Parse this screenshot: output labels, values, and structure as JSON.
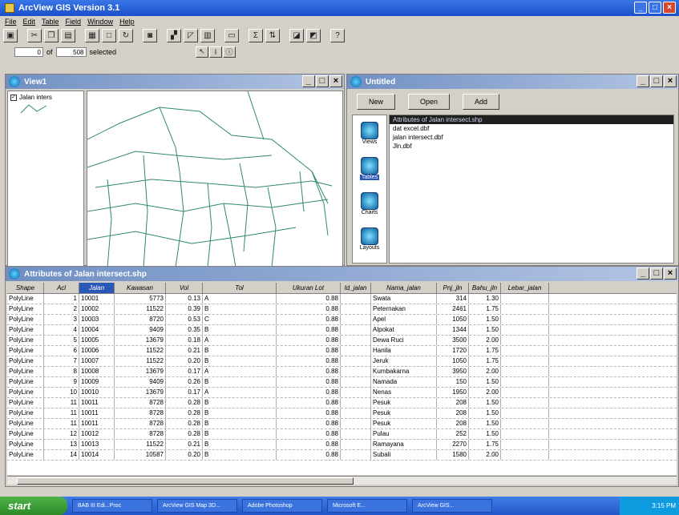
{
  "app": {
    "title": "ArcView GIS Version 3.1"
  },
  "menu": [
    "File",
    "Edit",
    "Table",
    "Field",
    "Window",
    "Help"
  ],
  "selection": {
    "count": "0",
    "of_label": "of",
    "total": "508",
    "selected_label": "selected"
  },
  "view_window": {
    "title": "View1",
    "toc_layers": [
      {
        "label": "Jalan inters",
        "checked": true
      }
    ]
  },
  "project_window": {
    "title": "Untitled",
    "buttons": [
      "New",
      "Open",
      "Add"
    ],
    "doc_types": [
      {
        "label": "Views",
        "selected": false
      },
      {
        "label": "Tables",
        "selected": true
      },
      {
        "label": "Charts",
        "selected": false
      },
      {
        "label": "Layouts",
        "selected": false
      }
    ],
    "tables": [
      {
        "name": "Attributes of Jalan intersect.shp",
        "selected": true
      },
      {
        "name": "dat excel.dbf",
        "selected": false
      },
      {
        "name": "jalan intersect.dbf",
        "selected": false
      },
      {
        "name": "Jln.dbf",
        "selected": false
      }
    ]
  },
  "table_window": {
    "title": "Attributes of Jalan intersect.shp",
    "columns": [
      {
        "label": "Shape",
        "selected": false
      },
      {
        "label": "Acl",
        "selected": false
      },
      {
        "label": "Jalan",
        "selected": true
      },
      {
        "label": "Kawasan",
        "selected": false
      },
      {
        "label": "Vol",
        "selected": false
      },
      {
        "label": "Tol",
        "selected": false
      },
      {
        "label": "Ukuran Lot",
        "selected": false
      },
      {
        "label": "Id_jalan",
        "selected": false
      },
      {
        "label": "Nama_jalan",
        "selected": false
      },
      {
        "label": "Pnj_jln",
        "selected": false
      },
      {
        "label": "Bahu_jln",
        "selected": false
      },
      {
        "label": "Lebar_jalan",
        "selected": false
      }
    ],
    "rows": [
      [
        "PolyLine",
        "1",
        "10001",
        "5773",
        "0.13",
        "A",
        "0.88",
        "",
        "Swata",
        "314",
        "1.30",
        ""
      ],
      [
        "PolyLine",
        "2",
        "10002",
        "11522",
        "0.39",
        "B",
        "0.88",
        "",
        "Peternakan",
        "2461",
        "1.75",
        ""
      ],
      [
        "PolyLine",
        "3",
        "10003",
        "8720",
        "0.53",
        "C",
        "0.88",
        "",
        "Apel",
        "1050",
        "1.50",
        ""
      ],
      [
        "PolyLine",
        "4",
        "10004",
        "9409",
        "0.35",
        "B",
        "0.88",
        "",
        "Alpokat",
        "1344",
        "1.50",
        ""
      ],
      [
        "PolyLine",
        "5",
        "10005",
        "13679",
        "0.18",
        "A",
        "0.88",
        "",
        "Dewa Ruci",
        "3500",
        "2.00",
        ""
      ],
      [
        "PolyLine",
        "6",
        "10006",
        "11522",
        "0.21",
        "B",
        "0.88",
        "",
        "Hanila",
        "1720",
        "1.75",
        ""
      ],
      [
        "PolyLine",
        "7",
        "10007",
        "11522",
        "0.20",
        "B",
        "0.88",
        "",
        "Jeruk",
        "1050",
        "1.75",
        ""
      ],
      [
        "PolyLine",
        "8",
        "10008",
        "13679",
        "0.17",
        "A",
        "0.88",
        "",
        "Kumbakarna",
        "3950",
        "2.00",
        ""
      ],
      [
        "PolyLine",
        "9",
        "10009",
        "9409",
        "0.26",
        "B",
        "0.88",
        "",
        "Namada",
        "150",
        "1.50",
        ""
      ],
      [
        "PolyLine",
        "10",
        "10010",
        "13679",
        "0.17",
        "A",
        "0.88",
        "",
        "Nenas",
        "1950",
        "2.00",
        ""
      ],
      [
        "PolyLine",
        "11",
        "10011",
        "8728",
        "0.28",
        "B",
        "0.88",
        "",
        "Pesuk",
        "208",
        "1.50",
        ""
      ],
      [
        "PolyLine",
        "11",
        "10011",
        "8728",
        "0.28",
        "B",
        "0.88",
        "",
        "Pesuk",
        "208",
        "1.50",
        ""
      ],
      [
        "PolyLine",
        "11",
        "10011",
        "8728",
        "0.28",
        "B",
        "0.88",
        "",
        "Pesuk",
        "208",
        "1.50",
        ""
      ],
      [
        "PolyLine",
        "12",
        "10012",
        "8728",
        "0.28",
        "B",
        "0.88",
        "",
        "Pulau",
        "252",
        "1.50",
        ""
      ],
      [
        "PolyLine",
        "13",
        "10013",
        "11522",
        "0.21",
        "B",
        "0.88",
        "",
        "Ramayana",
        "2270",
        "1.75",
        ""
      ],
      [
        "PolyLine",
        "14",
        "10014",
        "10587",
        "0.20",
        "B",
        "0.88",
        "",
        "Subali",
        "1580",
        "2.00",
        ""
      ]
    ]
  },
  "taskbar": {
    "start_label": "start",
    "tasks": [
      "BAB III Edi...Proc",
      "ArcView GIS Map 3D...",
      "Adobe Photoshop",
      "Microsoft E...",
      "ArcView GIS..."
    ],
    "clock": "3:15 PM"
  },
  "colors": {
    "title_blue": "#1a4fc9",
    "road_line": "#2e8a6a",
    "selection_blue": "#2a58b8"
  }
}
